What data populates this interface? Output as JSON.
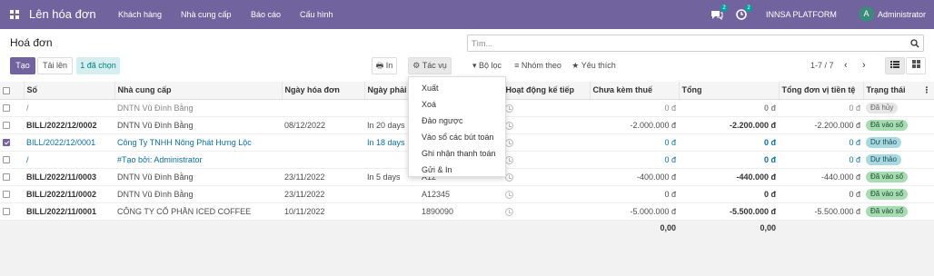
{
  "topbar": {
    "app_title": "Lên hóa đơn",
    "menu": [
      "Khách hàng",
      "Nhà cung cấp",
      "Báo cáo",
      "Cấu hình"
    ],
    "chat_count": "2",
    "activity_count": "2",
    "company": "INNSA PLATFORM",
    "avatar_letter": "A",
    "user": "Administrator"
  },
  "breadcrumb": "Hoá đơn",
  "search": {
    "placeholder": "Tìm..."
  },
  "buttons": {
    "create": "Tạo",
    "upload": "Tải lên",
    "selected": "1 đã chọn",
    "print": "In",
    "action": "Tác vụ",
    "filters": "Bộ lọc",
    "group_by": "Nhóm theo",
    "favorites": "Yêu thích"
  },
  "pager": "1-7 / 7",
  "action_menu": [
    "Xuất",
    "Xoá",
    "Đảo ngược",
    "Vào sổ các bút toán",
    "Ghi nhận thanh toán",
    "Gửi & In"
  ],
  "table": {
    "headers": [
      "Số",
      "Nhà cung cấp",
      "Ngày hóa đơn",
      "Ngày phải",
      "Hoạt động kế tiếp",
      "Chưa kèm thuế",
      "Tổng",
      "Tổng đơn vị tiền tệ",
      "Trạng thái"
    ],
    "rows": [
      {
        "num": "/",
        "vendor": "DNTN Vũ Đình Bằng",
        "date": "",
        "due": "",
        "ref": "",
        "untaxed": "0 đ",
        "total": "0 đ",
        "total_cur": "0 đ",
        "status": "Đã hủy",
        "kind": "cancel",
        "checked": false
      },
      {
        "num": "BILL/2022/12/0002",
        "vendor": "DNTN Vũ Đình Bằng",
        "date": "08/12/2022",
        "due": "In 20 days",
        "ref": "",
        "untaxed": "-2.000.000 đ",
        "total": "-2.200.000 đ",
        "total_cur": "-2.200.000 đ",
        "status": "Đã vào sổ",
        "kind": "posted",
        "checked": false
      },
      {
        "num": "BILL/2022/12/0001",
        "vendor": "Công Ty TNHH Nông Phát Hưng Lộc",
        "date": "",
        "due": "In 18 days",
        "ref": "",
        "untaxed": "0 đ",
        "total": "0 đ",
        "total_cur": "0 đ",
        "status": "Dự thảo",
        "kind": "draft",
        "checked": true
      },
      {
        "num": "/",
        "vendor": "#Tạo bởi: Administrator",
        "date": "",
        "due": "",
        "ref": "",
        "untaxed": "0 đ",
        "total": "0 đ",
        "total_cur": "0 đ",
        "status": "Dự thảo",
        "kind": "draft",
        "checked": false
      },
      {
        "num": "BILL/2022/11/0003",
        "vendor": "DNTN Vũ Đình Bằng",
        "date": "23/11/2022",
        "due": "In 5 days",
        "ref": "A12",
        "untaxed": "-400.000 đ",
        "total": "-440.000 đ",
        "total_cur": "-440.000 đ",
        "status": "Đã vào sổ",
        "kind": "posted",
        "checked": false
      },
      {
        "num": "BILL/2022/11/0002",
        "vendor": "DNTN Vũ Đình Bằng",
        "date": "23/11/2022",
        "due": "",
        "ref": "A12345",
        "untaxed": "0 đ",
        "total": "0 đ",
        "total_cur": "0 đ",
        "status": "Đã vào sổ",
        "kind": "posted",
        "checked": false
      },
      {
        "num": "BILL/2022/11/0001",
        "vendor": "CÔNG TY CỔ PHẦN ICED COFFEE",
        "date": "10/11/2022",
        "due": "",
        "ref": "1890090",
        "untaxed": "-5.000.000 đ",
        "total": "-5.500.000 đ",
        "total_cur": "-5.500.000 đ",
        "status": "Đã vào sổ",
        "kind": "posted",
        "checked": false
      }
    ],
    "footer": {
      "untaxed": "0,00",
      "total": "0,00"
    }
  },
  "colors": {
    "brand": "#71639e",
    "posted": "#a7dcb3",
    "draft": "#a8d8e0",
    "cancel": "#e6e6e6"
  }
}
